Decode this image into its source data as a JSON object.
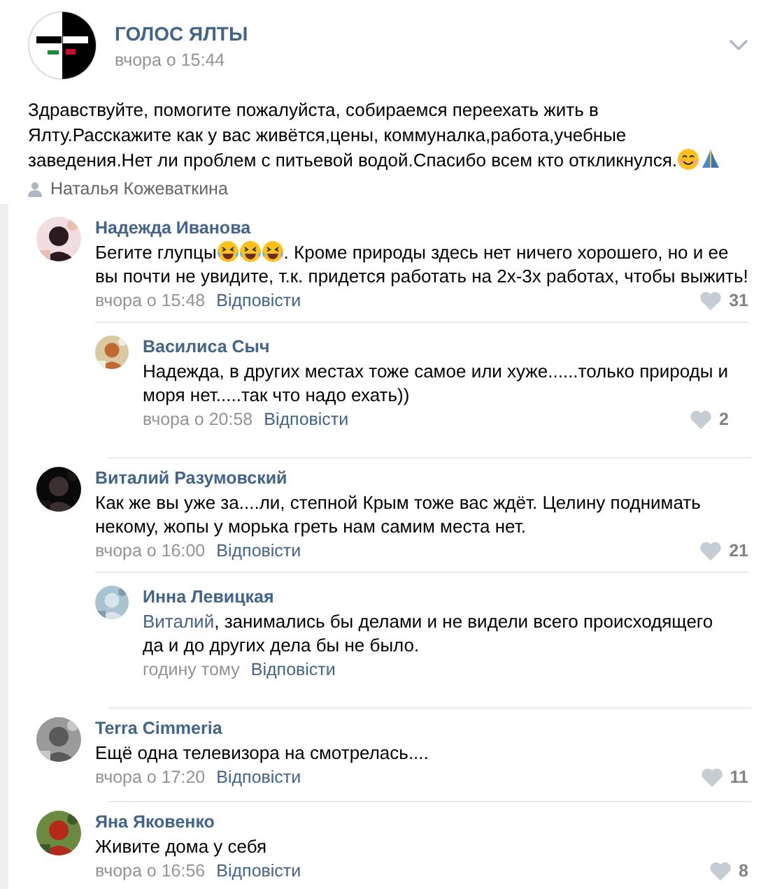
{
  "post": {
    "group_name": "ГОЛОС ЯЛТЫ",
    "time": "вчора о 15:44",
    "author": "Наталья Кожеваткина",
    "text": [
      {
        "kind": "text",
        "text": "Здравствуйте, помогите пожалуйста, собираемся переехать жить в Ялту.Расскажите как у вас живётся,цены, коммуналка,работа,учебные заведения.Нет ли проблем с питьевой водой.Спасибо всем кто откликнулся."
      },
      {
        "kind": "smile"
      },
      {
        "kind": "pray"
      }
    ]
  },
  "comments": [
    {
      "author": "Надежда Иванова",
      "time": "вчора о 15:48",
      "reply_label": "Відповісти",
      "likes": "31",
      "text": [
        {
          "kind": "text",
          "text": "Бегите глупцы"
        },
        {
          "kind": "laugh"
        },
        {
          "kind": "laugh"
        },
        {
          "kind": "laugh"
        },
        {
          "kind": "text",
          "text": ". Кроме природы здесь нет ничего хорошего, но и ее вы почти не увидите, т.к. придется работать на 2х-3х работах, чтобы выжить!"
        }
      ],
      "replies": [
        {
          "author": "Василиса Сыч",
          "time": "вчора о 20:58",
          "reply_label": "Відповісти",
          "likes": "2",
          "text": [
            {
              "kind": "text",
              "text": "Надежда, в других местах тоже самое или хуже......только природы и моря нет.....так что надо ехать))"
            }
          ]
        }
      ]
    },
    {
      "author": "Виталий Разумовский",
      "time": "вчора о 16:00",
      "reply_label": "Відповісти",
      "likes": "21",
      "text": [
        {
          "kind": "text",
          "text": "Как же вы уже за....ли, степной Крым тоже вас ждёт. Целину поднимать некому, жопы у морька греть нам самим места нет."
        }
      ],
      "replies": [
        {
          "author": "Инна Левицкая",
          "time": "годину тому",
          "reply_label": "Відповісти",
          "text": [
            {
              "kind": "mention",
              "text": "Виталий"
            },
            {
              "kind": "text",
              "text": ", занимались бы делами и не видели всего происходящего да и до других дела бы не было."
            }
          ]
        }
      ]
    },
    {
      "author": "Terra Cimmeria",
      "time": "вчора о 17:20",
      "reply_label": "Відповісти",
      "likes": "11",
      "text": [
        {
          "kind": "text",
          "text": "Ещё одна телевизора на смотрелась...."
        }
      ]
    },
    {
      "author": "Яна Яковенко",
      "time": "вчора о 16:56",
      "reply_label": "Відповісти",
      "likes": "8",
      "text": [
        {
          "kind": "text",
          "text": "Живите дома у себя"
        }
      ]
    }
  ]
}
